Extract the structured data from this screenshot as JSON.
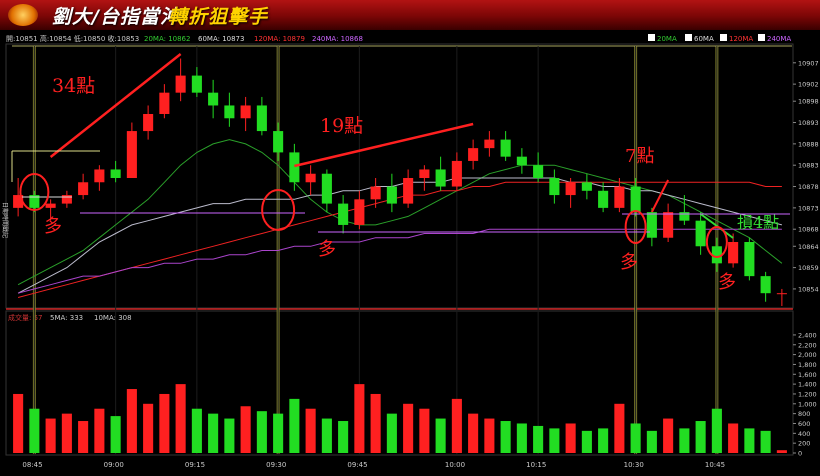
{
  "banner": {
    "title_part1": "劉大/台指當沖",
    "title_part2": "轉折狙擊手"
  },
  "price_header": {
    "ohlc": "開:10851 高:10854 低:10850 收:10853",
    "ma20": "20MA: 10862",
    "ma60": "60MA: 10873",
    "ma120": "120MA: 10879",
    "ma240": "240MA: 10868"
  },
  "legend": [
    {
      "label": "20MA",
      "color": "#33cc33"
    },
    {
      "label": "60MA",
      "color": "#ffffff"
    },
    {
      "label": "120MA",
      "color": "#ff3333"
    },
    {
      "label": "240MA",
      "color": "#cc66ff"
    }
  ],
  "volume_header": {
    "vol": "成交量: 57",
    "ma5": "5MA: 333",
    "ma10": "10MA: 308"
  },
  "side_label": "日期時間戳記",
  "colors": {
    "up": "#ff2020",
    "down": "#22dd22",
    "ma20": "#2aa02a",
    "ma60": "#bbbbcc",
    "ma120": "#ee2222",
    "ma240": "#aa44cc",
    "annotation": "#ff2020",
    "marker": "#888830"
  },
  "chart_data": {
    "type": "candlestick",
    "price_axis": {
      "ticks": [
        10907,
        10902,
        10898,
        10893,
        10888,
        10883,
        10878,
        10873,
        10868,
        10864,
        10859,
        10854
      ],
      "range": [
        10850,
        10910
      ]
    },
    "volume_axis": {
      "ticks": [
        0,
        200,
        400,
        600,
        800,
        1000,
        1200,
        1400,
        1600,
        1800,
        2000,
        2200,
        2400
      ],
      "range": [
        0,
        2500
      ]
    },
    "x_ticks": [
      "08:45",
      "09:00",
      "09:15",
      "09:30",
      "09:45",
      "10:00",
      "10:15",
      "10:30",
      "10:45"
    ],
    "annotations": [
      {
        "text": "34點",
        "color": "#ff2020"
      },
      {
        "text": "19點",
        "color": "#ff2020"
      },
      {
        "text": "7點",
        "color": "#ff2020"
      },
      {
        "text": "損4點",
        "color": "#33dd33"
      },
      {
        "text": "多",
        "color": "#ff2020"
      },
      {
        "text": "多",
        "color": "#ff2020"
      },
      {
        "text": "多",
        "color": "#ff2020"
      },
      {
        "text": "多",
        "color": "#ff2020"
      }
    ],
    "series": [
      {
        "name": "20MA",
        "values": [
          10855,
          10857,
          10859,
          10861,
          10863,
          10866,
          10869,
          10872,
          10875,
          10879,
          10883,
          10886,
          10888,
          10889,
          10888,
          10886,
          10883,
          10879,
          10875,
          10872,
          10870,
          10869,
          10869,
          10870,
          10871,
          10873,
          10875,
          10877,
          10879,
          10881,
          10882,
          10883,
          10883,
          10883,
          10882,
          10881,
          10880,
          10879,
          10878,
          10877,
          10876,
          10874,
          10872,
          10870,
          10868,
          10866,
          10863,
          10860
        ]
      },
      {
        "name": "60MA",
        "values": [
          10853,
          10855,
          10857,
          10859,
          10862,
          10865,
          10867,
          10869,
          10870,
          10871,
          10872,
          10873,
          10874,
          10874,
          10875,
          10875,
          10875,
          10875,
          10876,
          10876,
          10877,
          10877,
          10878,
          10878,
          10879,
          10879,
          10879,
          10880,
          10880,
          10880,
          10880,
          10880,
          10880,
          10880,
          10879,
          10879,
          10878,
          10878,
          10877,
          10877,
          10876,
          10875,
          10874,
          10873,
          10872,
          10871,
          10870,
          10869
        ]
      },
      {
        "name": "120MA",
        "values": [
          10852,
          10853,
          10854,
          10855,
          10856,
          10857,
          10858,
          10859,
          10860,
          10861,
          10862,
          10863,
          10864,
          10865,
          10866,
          10867,
          10868,
          10869,
          10870,
          10871,
          10872,
          10873,
          10874,
          10875,
          10876,
          10876,
          10877,
          10877,
          10878,
          10878,
          10879,
          10879,
          10879,
          10879,
          10879,
          10879,
          10879,
          10879,
          10879,
          10879,
          10879,
          10879,
          10879,
          10879,
          10879,
          10879,
          10878,
          10878
        ]
      },
      {
        "name": "240MA",
        "values": [
          10853,
          10854,
          10855,
          10856,
          10857,
          10857,
          10858,
          10859,
          10859,
          10860,
          10860,
          10861,
          10861,
          10862,
          10862,
          10863,
          10863,
          10864,
          10864,
          10865,
          10865,
          10865,
          10866,
          10866,
          10866,
          10867,
          10867,
          10867,
          10867,
          10868,
          10868,
          10868,
          10868,
          10868,
          10868,
          10868,
          10868,
          10868,
          10868,
          10868,
          10868,
          10868,
          10868,
          10868,
          10868,
          10868,
          10868,
          10868
        ]
      }
    ],
    "candles": [
      [
        10873,
        10880,
        10871,
        10876
      ],
      [
        10876,
        10877,
        10872,
        10873
      ],
      [
        10873,
        10875,
        10870,
        10874
      ],
      [
        10874,
        10877,
        10873,
        10876
      ],
      [
        10876,
        10881,
        10875,
        10879
      ],
      [
        10879,
        10883,
        10877,
        10882
      ],
      [
        10882,
        10884,
        10879,
        10880
      ],
      [
        10880,
        10893,
        10880,
        10891
      ],
      [
        10891,
        10897,
        10889,
        10895
      ],
      [
        10895,
        10902,
        10894,
        10900
      ],
      [
        10900,
        10908,
        10898,
        10904
      ],
      [
        10904,
        10906,
        10899,
        10900
      ],
      [
        10900,
        10903,
        10894,
        10897
      ],
      [
        10897,
        10900,
        10892,
        10894
      ],
      [
        10894,
        10899,
        10891,
        10897
      ],
      [
        10897,
        10899,
        10890,
        10891
      ],
      [
        10891,
        10893,
        10884,
        10886
      ],
      [
        10886,
        10888,
        10877,
        10879
      ],
      [
        10879,
        10883,
        10876,
        10881
      ],
      [
        10881,
        10882,
        10872,
        10874
      ],
      [
        10874,
        10876,
        10867,
        10869
      ],
      [
        10869,
        10877,
        10868,
        10875
      ],
      [
        10875,
        10880,
        10873,
        10878
      ],
      [
        10878,
        10881,
        10872,
        10874
      ],
      [
        10874,
        10882,
        10873,
        10880
      ],
      [
        10880,
        10883,
        10877,
        10882
      ],
      [
        10882,
        10885,
        10877,
        10878
      ],
      [
        10878,
        10886,
        10877,
        10884
      ],
      [
        10884,
        10889,
        10882,
        10887
      ],
      [
        10887,
        10891,
        10885,
        10889
      ],
      [
        10889,
        10891,
        10884,
        10885
      ],
      [
        10885,
        10887,
        10881,
        10883
      ],
      [
        10883,
        10886,
        10879,
        10880
      ],
      [
        10880,
        10882,
        10874,
        10876
      ],
      [
        10876,
        10880,
        10873,
        10879
      ],
      [
        10879,
        10881,
        10875,
        10877
      ],
      [
        10877,
        10879,
        10872,
        10873
      ],
      [
        10873,
        10880,
        10872,
        10878
      ],
      [
        10878,
        10880,
        10871,
        10872
      ],
      [
        10872,
        10873,
        10864,
        10866
      ],
      [
        10866,
        10874,
        10865,
        10872
      ],
      [
        10872,
        10876,
        10869,
        10870
      ],
      [
        10870,
        10872,
        10862,
        10864
      ],
      [
        10864,
        10866,
        10858,
        10860
      ],
      [
        10860,
        10867,
        10859,
        10865
      ],
      [
        10865,
        10866,
        10856,
        10857
      ],
      [
        10857,
        10858,
        10851,
        10853
      ],
      [
        10853,
        10854,
        10850,
        10853
      ]
    ],
    "volume": [
      1200,
      900,
      700,
      800,
      650,
      900,
      750,
      1300,
      1000,
      1200,
      1400,
      900,
      800,
      700,
      950,
      850,
      800,
      1100,
      900,
      700,
      650,
      1400,
      1200,
      800,
      1000,
      900,
      700,
      1100,
      800,
      700,
      650,
      600,
      550,
      500,
      600,
      450,
      500,
      1000,
      600,
      450,
      700,
      500,
      650,
      900,
      600,
      500,
      450,
      57
    ]
  }
}
